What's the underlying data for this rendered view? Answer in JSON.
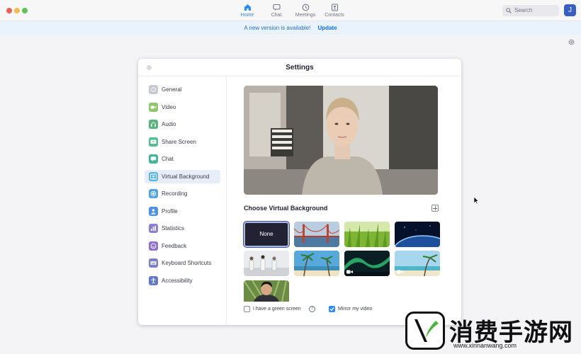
{
  "titlebar": {
    "nav": [
      {
        "label": "Home",
        "icon": "home-icon",
        "active": true
      },
      {
        "label": "Chat",
        "icon": "chat-icon",
        "active": false
      },
      {
        "label": "Meetings",
        "icon": "clock-icon",
        "active": false
      },
      {
        "label": "Contacts",
        "icon": "contacts-icon",
        "active": false
      }
    ],
    "search_label": "Search",
    "avatar_initial": "J"
  },
  "banner": {
    "message": "A new version is available!",
    "link": "Update"
  },
  "settings": {
    "title": "Settings",
    "sidebar": [
      {
        "label": "General",
        "icon": "gear-icon",
        "color": "#c9c9d1"
      },
      {
        "label": "Video",
        "icon": "video-icon",
        "color": "#8fc56c"
      },
      {
        "label": "Audio",
        "icon": "headphones-icon",
        "color": "#56b67a"
      },
      {
        "label": "Share Screen",
        "icon": "share-screen-icon",
        "color": "#4fbf8f"
      },
      {
        "label": "Chat",
        "icon": "chat-bubble-icon",
        "color": "#44b59c"
      },
      {
        "label": "Virtual Background",
        "icon": "virtual-background-icon",
        "color": "#5ab7e4",
        "active": true
      },
      {
        "label": "Recording",
        "icon": "recording-icon",
        "color": "#4ea6e6"
      },
      {
        "label": "Profile",
        "icon": "profile-icon",
        "color": "#4d93e2"
      },
      {
        "label": "Statistics",
        "icon": "statistics-icon",
        "color": "#8b7fd6"
      },
      {
        "label": "Feedback",
        "icon": "feedback-icon",
        "color": "#8d73cf"
      },
      {
        "label": "Keyboard Shortcuts",
        "icon": "keyboard-icon",
        "color": "#7a80c9"
      },
      {
        "label": "Accessibility",
        "icon": "accessibility-icon",
        "color": "#6278c7"
      }
    ],
    "choose_heading": "Choose Virtual Background",
    "backgrounds": [
      {
        "label": "None",
        "selected": true
      },
      {
        "label": "",
        "scene": "golden-gate-bridge"
      },
      {
        "label": "",
        "scene": "grass"
      },
      {
        "label": "",
        "scene": "earth-from-space"
      },
      {
        "label": "",
        "scene": "office-people"
      },
      {
        "label": "",
        "scene": "beach-palms"
      },
      {
        "label": "",
        "scene": "aurora",
        "video": true
      },
      {
        "label": "",
        "scene": "tropical-beach",
        "video": true
      },
      {
        "label": "",
        "scene": "person-portrait"
      }
    ],
    "green_screen_label": "I have a green screen",
    "green_screen_checked": false,
    "mirror_label": "Mirror my video",
    "mirror_checked": true
  },
  "watermark": {
    "text": "消费手游网",
    "url": "www.xinnanwang.com"
  }
}
